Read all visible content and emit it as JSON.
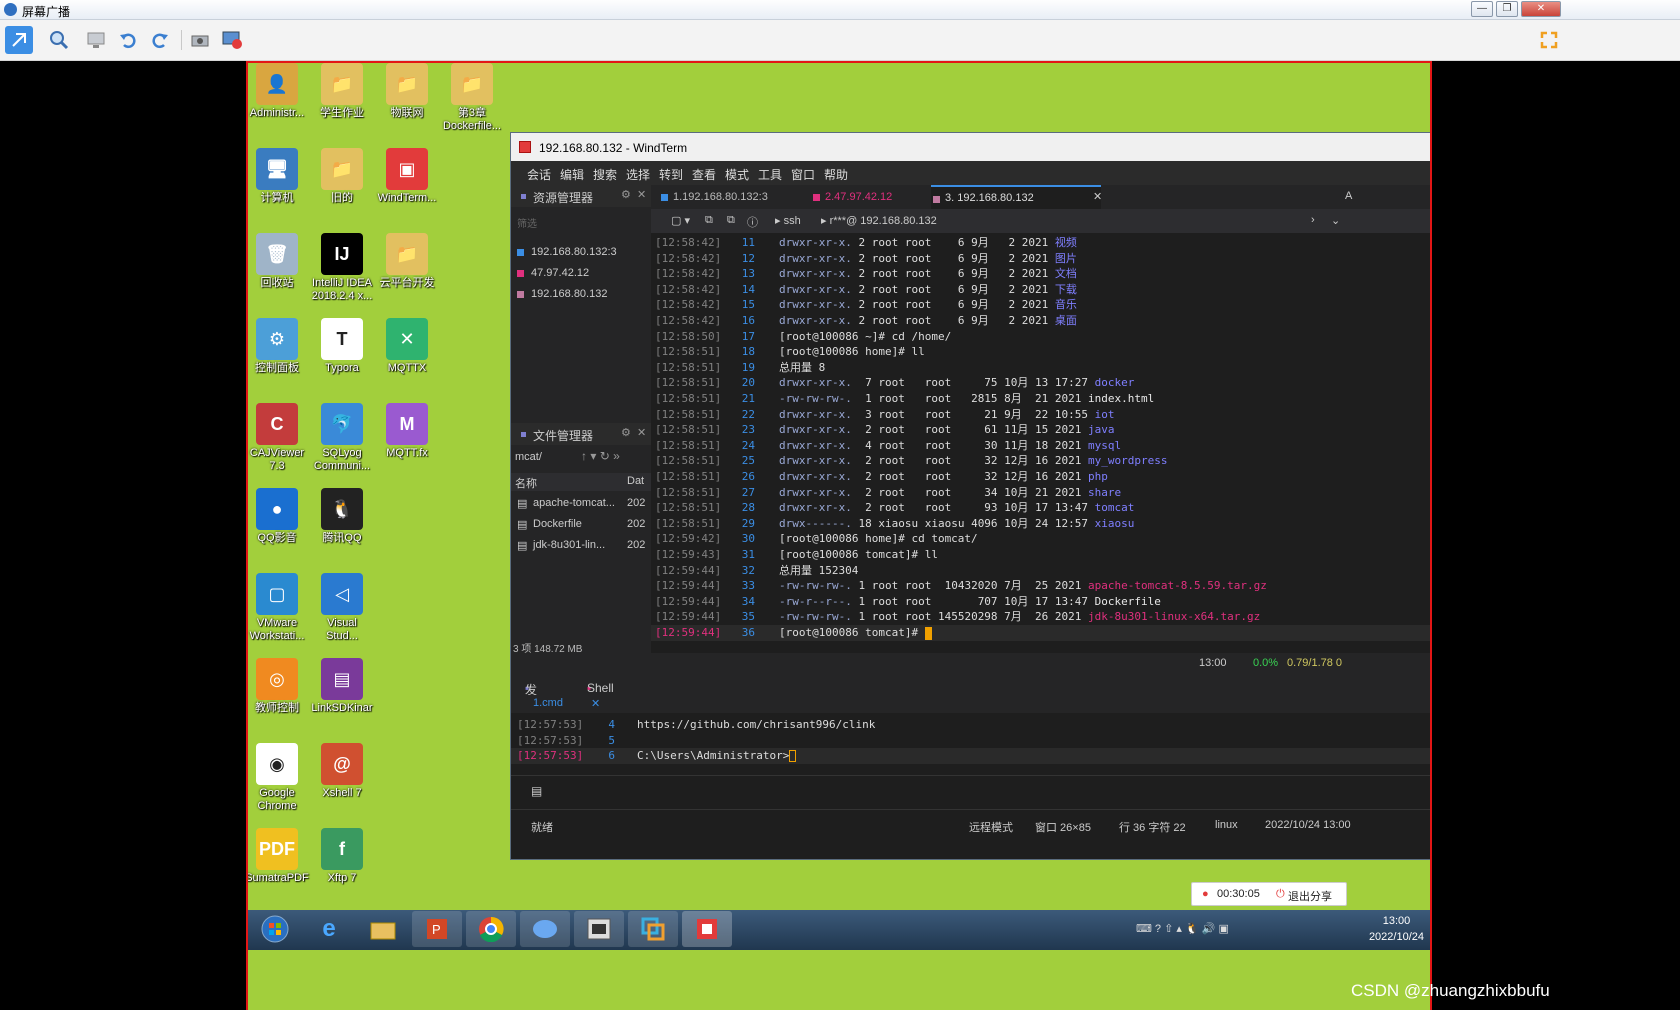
{
  "broadcast": {
    "title": "屏幕广播",
    "min_glyph": "—",
    "restore_glyph": "❐",
    "close_glyph": "✕"
  },
  "desktop": {
    "icons": [
      {
        "label": "Administr...",
        "color": "#d9a640",
        "glyph": "👤"
      },
      {
        "label": "学生作业",
        "color": "#e2c060",
        "glyph": "📁"
      },
      {
        "label": "物联网",
        "color": "#e2c060",
        "glyph": "📁"
      },
      {
        "label": "第3章\nDockerfile...",
        "color": "#e2c060",
        "glyph": "📁"
      },
      {
        "label": "计算机",
        "color": "#3a7cc0",
        "glyph": "🖥"
      },
      {
        "label": "旧的",
        "color": "#e2c060",
        "glyph": "📁"
      },
      {
        "label": "WindTerm...",
        "color": "#e23b3b",
        "glyph": "▣"
      },
      {
        "label": "回收站",
        "color": "#9fb4c8",
        "glyph": "🗑"
      },
      {
        "label": "IntelliJ IDEA\n2018.2.4 x...",
        "color": "#000000",
        "glyph": "IJ"
      },
      {
        "label": "云平台开发",
        "color": "#e2c060",
        "glyph": "📁"
      },
      {
        "label": "控制面板",
        "color": "#4c9fd8",
        "glyph": "⚙"
      },
      {
        "label": "Typora",
        "color": "#ffffff",
        "glyph": "T"
      },
      {
        "label": "MQTTX",
        "color": "#2fb36f",
        "glyph": "✕"
      },
      {
        "label": "CAJViewer\n7.3",
        "color": "#c33c3c",
        "glyph": "C"
      },
      {
        "label": "SQLyog\nCommuni...",
        "color": "#3a8ad8",
        "glyph": "🐬"
      },
      {
        "label": "MQTT.fx",
        "color": "#9a5ad0",
        "glyph": "M"
      },
      {
        "label": "QQ影音",
        "color": "#1a6fd0",
        "glyph": "●"
      },
      {
        "label": "腾讯QQ",
        "color": "#222222",
        "glyph": "🐧"
      },
      {
        "label": "VMware\nWorkstati...",
        "color": "#2a8ad0",
        "glyph": "▢"
      },
      {
        "label": "Visual\nStud...",
        "color": "#2a7ad0",
        "glyph": "◁"
      },
      {
        "label": "教师控制",
        "color": "#f08a20",
        "glyph": "◎"
      },
      {
        "label": "LinkSDKinar",
        "color": "#7a3a9a",
        "glyph": "▤"
      },
      {
        "label": "Google\nChrome",
        "color": "#ffffff",
        "glyph": "◉"
      },
      {
        "label": "Xshell 7",
        "color": "#d05030",
        "glyph": "@"
      },
      {
        "label": "SumatraPDF",
        "color": "#f0c020",
        "glyph": "PDF"
      },
      {
        "label": "Xftp 7",
        "color": "#3a9a60",
        "glyph": "f"
      }
    ]
  },
  "windterm": {
    "title": "192.168.80.132 - WindTerm",
    "menu": [
      "会话",
      "编辑",
      "搜索",
      "选择",
      "转到",
      "查看",
      "模式",
      "工具",
      "窗口",
      "帮助"
    ],
    "resource_panel": {
      "title": "资源管理器",
      "filter_placeholder": "筛选",
      "items": [
        {
          "label": "192.168.80.132:3",
          "color": "#3b8ee4"
        },
        {
          "label": "47.97.42.12",
          "color": "#e0307e"
        },
        {
          "label": "192.168.80.132",
          "color": "#c07aa0"
        }
      ]
    },
    "file_panel": {
      "title": "文件管理器",
      "path": "mcat/",
      "col_name": "名称",
      "col_date": "Dat",
      "files": [
        {
          "name": "apache-tomcat...",
          "date": "202"
        },
        {
          "name": "Dockerfile",
          "date": "202"
        },
        {
          "name": "jdk-8u301-lin...",
          "date": "202"
        }
      ],
      "summary": "3 项 148.72 MB"
    },
    "tabs": [
      {
        "label": "1.192.168.80.132:3",
        "color": "#3b8ee4"
      },
      {
        "label": "2.47.97.42.12",
        "color": "#e0307e"
      },
      {
        "label": "3. 192.168.80.132",
        "color": "#c07aa0"
      }
    ],
    "tab_close": "✕",
    "tab_right": "A",
    "address": {
      "proto": "ssh",
      "host": "r***@ 192.168.80.132"
    },
    "terminal": [
      {
        "ts": "[12:58:42]",
        "ln": "11",
        "perm": "drwxr-xr-x.",
        "rest": " 2 root root    6 9月   2 2021 ",
        "name": "视频",
        "nc": "c-dir"
      },
      {
        "ts": "[12:58:42]",
        "ln": "12",
        "perm": "drwxr-xr-x.",
        "rest": " 2 root root    6 9月   2 2021 ",
        "name": "图片",
        "nc": "c-dir"
      },
      {
        "ts": "[12:58:42]",
        "ln": "13",
        "perm": "drwxr-xr-x.",
        "rest": " 2 root root    6 9月   2 2021 ",
        "name": "文档",
        "nc": "c-dir"
      },
      {
        "ts": "[12:58:42]",
        "ln": "14",
        "perm": "drwxr-xr-x.",
        "rest": " 2 root root    6 9月   2 2021 ",
        "name": "下载",
        "nc": "c-dir"
      },
      {
        "ts": "[12:58:42]",
        "ln": "15",
        "perm": "drwxr-xr-x.",
        "rest": " 2 root root    6 9月   2 2021 ",
        "name": "音乐",
        "nc": "c-dir"
      },
      {
        "ts": "[12:58:42]",
        "ln": "16",
        "perm": "drwxr-xr-x.",
        "rest": " 2 root root    6 9月   2 2021 ",
        "name": "桌面",
        "nc": "c-dir"
      },
      {
        "ts": "[12:58:50]",
        "ln": "17",
        "perm": "",
        "rest": "[root@100086 ~]# cd /home/",
        "name": "",
        "nc": ""
      },
      {
        "ts": "[12:58:51]",
        "ln": "18",
        "perm": "",
        "rest": "[root@100086 home]# ll",
        "name": "",
        "nc": ""
      },
      {
        "ts": "[12:58:51]",
        "ln": "19",
        "perm": "",
        "rest": "总用量 8",
        "name": "",
        "nc": ""
      },
      {
        "ts": "[12:58:51]",
        "ln": "20",
        "perm": "drwxr-xr-x.",
        "rest": "  7 root   root     75 10月 13 17:27 ",
        "name": "docker",
        "nc": "c-dir"
      },
      {
        "ts": "[12:58:51]",
        "ln": "21",
        "perm": "-rw-rw-rw-.",
        "rest": "  1 root   root   2815 8月  21 2021 ",
        "name": "index.html",
        "nc": "c-file"
      },
      {
        "ts": "[12:58:51]",
        "ln": "22",
        "perm": "drwxr-xr-x.",
        "rest": "  3 root   root     21 9月  22 10:55 ",
        "name": "iot",
        "nc": "c-dir"
      },
      {
        "ts": "[12:58:51]",
        "ln": "23",
        "perm": "drwxr-xr-x.",
        "rest": "  2 root   root     61 11月 15 2021 ",
        "name": "java",
        "nc": "c-dir"
      },
      {
        "ts": "[12:58:51]",
        "ln": "24",
        "perm": "drwxr-xr-x.",
        "rest": "  4 root   root     30 11月 18 2021 ",
        "name": "mysql",
        "nc": "c-dir"
      },
      {
        "ts": "[12:58:51]",
        "ln": "25",
        "perm": "drwxr-xr-x.",
        "rest": "  2 root   root     32 12月 16 2021 ",
        "name": "my_wordpress",
        "nc": "c-dir"
      },
      {
        "ts": "[12:58:51]",
        "ln": "26",
        "perm": "drwxr-xr-x.",
        "rest": "  2 root   root     32 12月 16 2021 ",
        "name": "php",
        "nc": "c-dir"
      },
      {
        "ts": "[12:58:51]",
        "ln": "27",
        "perm": "drwxr-xr-x.",
        "rest": "  2 root   root     34 10月 21 2021 ",
        "name": "share",
        "nc": "c-dir"
      },
      {
        "ts": "[12:58:51]",
        "ln": "28",
        "perm": "drwxr-xr-x.",
        "rest": "  2 root   root     93 10月 17 13:47 ",
        "name": "tomcat",
        "nc": "c-dir"
      },
      {
        "ts": "[12:58:51]",
        "ln": "29",
        "perm": "drwx------.",
        "rest": " 18 xiaosu xiaosu 4096 10月 24 12:57 ",
        "name": "xiaosu",
        "nc": "c-dir"
      },
      {
        "ts": "[12:59:42]",
        "ln": "30",
        "perm": "",
        "rest": "[root@100086 home]# cd tomcat/",
        "name": "",
        "nc": ""
      },
      {
        "ts": "[12:59:43]",
        "ln": "31",
        "perm": "",
        "rest": "[root@100086 tomcat]# ll",
        "name": "",
        "nc": ""
      },
      {
        "ts": "[12:59:44]",
        "ln": "32",
        "perm": "",
        "rest": "总用量 152304",
        "name": "",
        "nc": ""
      },
      {
        "ts": "[12:59:44]",
        "ln": "33",
        "perm": "-rw-rw-rw-.",
        "rest": " 1 root root  10432020 7月  25 2021 ",
        "name": "apache-tomcat-8.5.59.tar.gz",
        "nc": "c-red"
      },
      {
        "ts": "[12:59:44]",
        "ln": "34",
        "perm": "-rw-r--r--.",
        "rest": " 1 root root       707 10月 17 13:47 ",
        "name": "Dockerfile",
        "nc": "c-file"
      },
      {
        "ts": "[12:59:44]",
        "ln": "35",
        "perm": "-rw-rw-rw-.",
        "rest": " 1 root root 145520298 7月  26 2021 ",
        "name": "jdk-8u301-linux-x64.tar.gz",
        "nc": "c-red"
      },
      {
        "ts": "[12:59:44]",
        "ln": "36",
        "perm": "",
        "rest": "[root@100086 tomcat]# ",
        "name": "",
        "nc": "cursor"
      }
    ],
    "status_term": {
      "time": "13:00",
      "cpu": "0.0%",
      "load": "0.79/1.78 0"
    },
    "shell_tabs": {
      "send": "发送",
      "shell": "Shell"
    },
    "cmd_tab": "1.cmd",
    "cmd_lines": [
      {
        "ts": "[12:57:53]",
        "ln": "4",
        "tx": "https://github.com/chrisant996/clink"
      },
      {
        "ts": "[12:57:53]",
        "ln": "5",
        "tx": ""
      },
      {
        "ts": "[12:57:53]",
        "ln": "6",
        "tx": "C:\\Users\\Administrator>"
      }
    ],
    "status": {
      "ready": "就绪",
      "mode": "远程模式",
      "window": "窗口 26×85",
      "pos": "行 36 字符 22",
      "os": "linux",
      "datetime": "2022/10/24 13:00"
    }
  },
  "share_bar": {
    "timer": "00:30:05",
    "exit": "退出分享"
  },
  "taskbar": {
    "time": "13:00",
    "date": "2022/10/24"
  },
  "watermark": "CSDN @zhuangzhixbbufu"
}
